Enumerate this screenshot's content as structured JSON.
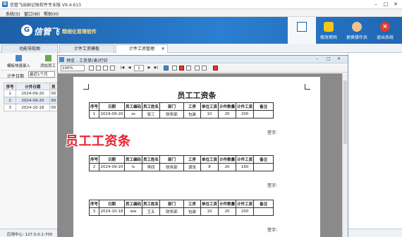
{
  "app": {
    "title": "信管飞出纳记账软件专业版 V9.4.613",
    "icon": "G"
  },
  "menu": [
    "系统(S)",
    "窗口(W)",
    "帮助(H)"
  ],
  "banner": {
    "brand": "信管飞",
    "tagline": "精细化管理软件",
    "buttons": [
      {
        "label": "",
        "icon": "list-icon"
      },
      {
        "label": "修改密码",
        "icon": "lock-icon"
      },
      {
        "label": "更换操作员",
        "icon": "user-icon"
      },
      {
        "label": "退出系统",
        "icon": "exit-icon"
      }
    ]
  },
  "tabs": [
    "功能导航图",
    "计件工资模板",
    "计件工资管理"
  ],
  "left": {
    "btn1": "模板快速录入",
    "btn2": "添加员工",
    "filter_label": "计件日期",
    "filter_value": "最近1个月",
    "headers": [
      "序号",
      "计件日期",
      "员"
    ],
    "rows": [
      [
        "1",
        "2024-09-20",
        "00"
      ],
      [
        "2",
        "2024-09-20",
        "00"
      ],
      [
        "3",
        "2024-10-18",
        "00"
      ]
    ]
  },
  "status": "应用中心: 127.0.0.1:700",
  "preview": {
    "title": "预览 - 工资单(表)打印",
    "zoom": "100%",
    "page": "1"
  },
  "report": {
    "title": "员工工资条",
    "headers": [
      "序号",
      "日期",
      "员工编码",
      "员工姓名",
      "部门",
      "工序",
      "单位工资",
      "计件数量",
      "计件工资",
      "备注"
    ],
    "sign_label": "签字:",
    "rows": [
      [
        "1",
        "2024-09-20",
        "zs",
        "张三",
        "财务部",
        "包装",
        "10",
        "20",
        "200",
        ""
      ],
      [
        "2",
        "2024-09-20",
        "ls",
        "李四",
        "财务部",
        "调洗",
        "8",
        "20",
        "160",
        ""
      ],
      [
        "3",
        "2024-10-18",
        "ww",
        "王五",
        "财务部",
        "包装",
        "10",
        "20",
        "200",
        ""
      ]
    ]
  },
  "overlay_caption": "员工工资条",
  "colors": {
    "banner": "#2b7fd0",
    "accent_red": "#e8222c"
  }
}
